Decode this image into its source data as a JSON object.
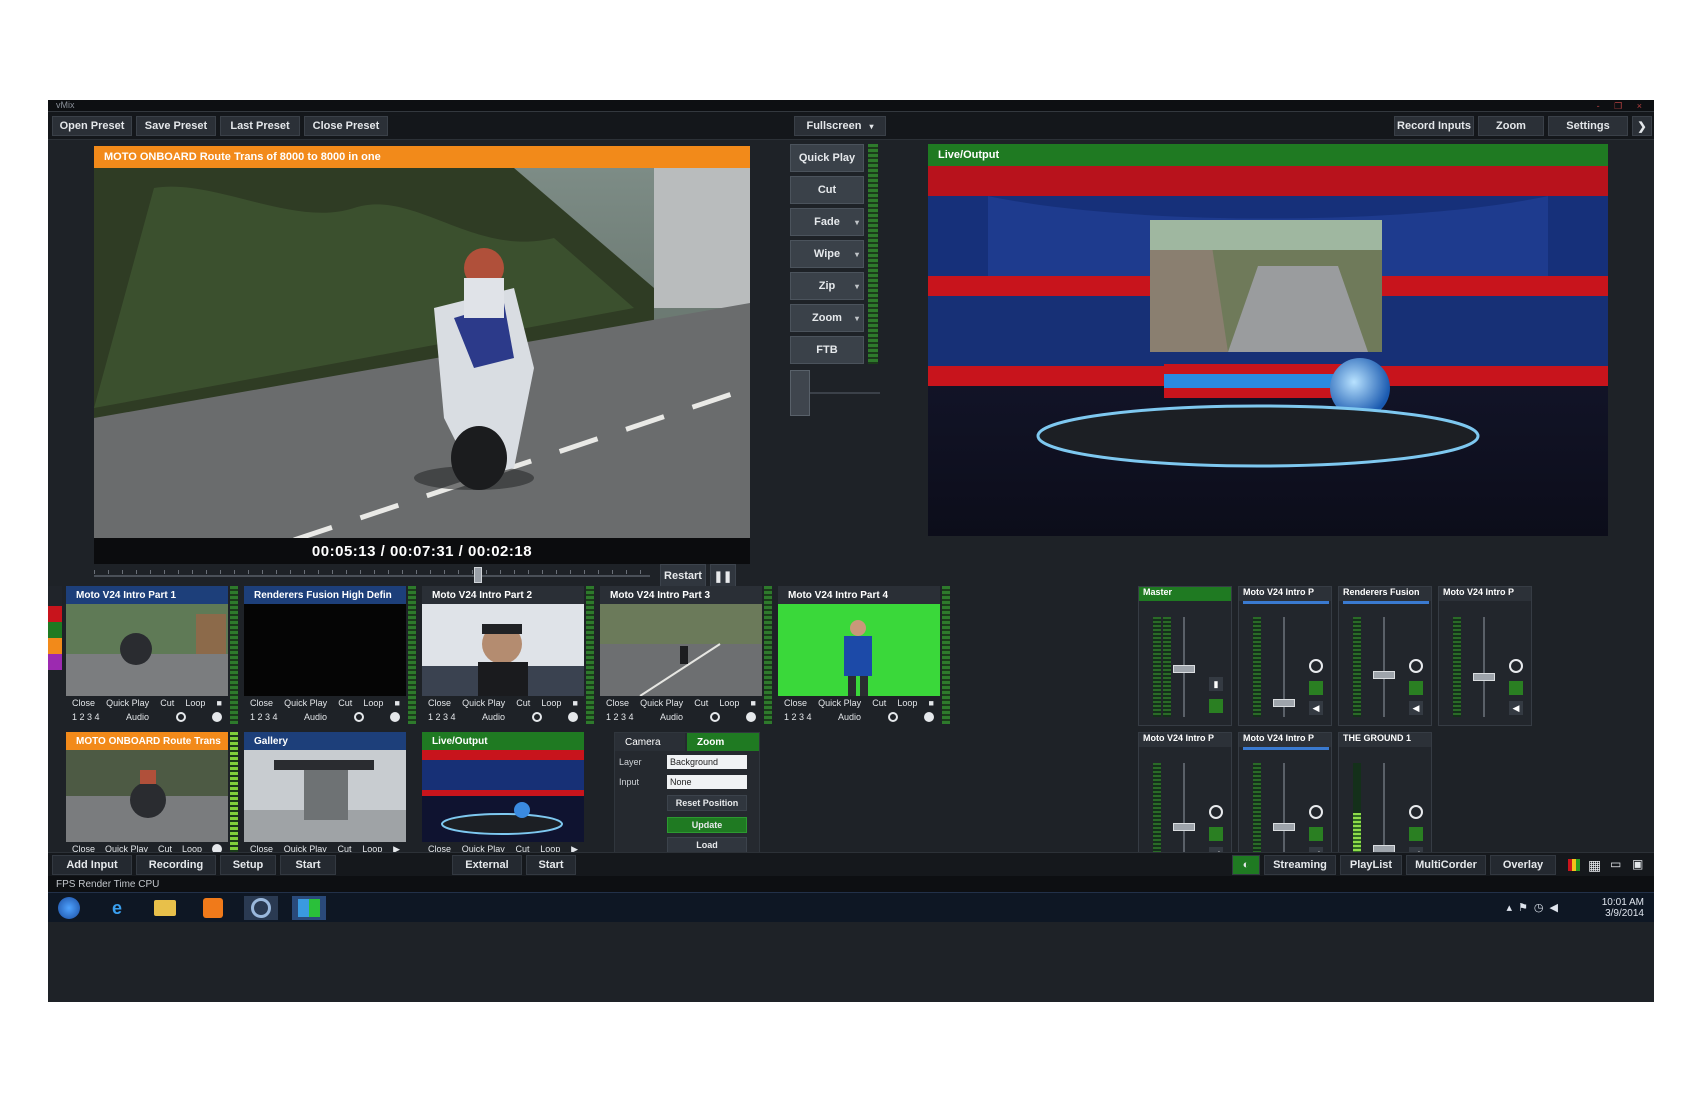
{
  "window": {
    "title": "vMix",
    "controls": "- ❐ ×"
  },
  "toolbar": {
    "left": [
      "Open Preset",
      "Save Preset",
      "Last Preset",
      "Close Preset"
    ],
    "center": "Fullscreen",
    "right": [
      "Record Inputs",
      "Zoom",
      "Settings",
      "❯"
    ]
  },
  "preview": {
    "caption": "MOTO ONBOARD Route Trans of 8000 to 8000 in one",
    "timecode": "00:05:13 / 00:07:31 / 00:02:18",
    "transport": {
      "button": "Restart",
      "pause": "❚❚"
    }
  },
  "transitions": [
    "Quick Play",
    "Cut",
    "Fade",
    "Wipe",
    "Zip",
    "Zoom",
    "FTB"
  ],
  "output": {
    "caption": "Live/Output"
  },
  "inputs_row1": [
    {
      "caption": "Moto V24 Intro Part 1",
      "cap_color": "blue",
      "bottom": "1 2 3 4"
    },
    {
      "caption": "Renderers Fusion High Defin",
      "cap_color": "blue",
      "bottom": "1 2 3 4"
    },
    {
      "caption": "Moto V24 Intro Part 2",
      "cap_color": "dark",
      "bottom": "1 2 3 4"
    },
    {
      "caption": "Moto V24 Intro Part 3",
      "cap_color": "dark",
      "bottom": "1 2 3 4"
    },
    {
      "caption": "Moto V24 Intro Part 4",
      "cap_color": "dark",
      "bottom": "1 2 3 4"
    }
  ],
  "inputs_row2": [
    {
      "caption": "MOTO ONBOARD Route Trans",
      "cap_color": "orange"
    },
    {
      "caption": "Gallery",
      "cap_color": "blue"
    },
    {
      "caption": "Live/Output",
      "cap_color": "green"
    }
  ],
  "input_controls": {
    "close": "Close",
    "quick_play": "Quick Play",
    "cut": "Cut",
    "loop": "Loop",
    "audio": "Audio"
  },
  "controls_panel": {
    "tab_camera": "Camera",
    "tab_zoom": "Zoom",
    "layer_label": "Layer",
    "layer_value": "Background",
    "input_label": "Input",
    "input_value": "None",
    "reset_btn": "Reset Position",
    "update_btn": "Update",
    "load_btn": "Load"
  },
  "mixers": [
    {
      "name": "Master",
      "header": "green"
    },
    {
      "name": "Moto V24 Intro P",
      "header": "dark"
    },
    {
      "name": "Renderers Fusion",
      "header": "dark"
    },
    {
      "name": "Moto V24 Intro P",
      "header": "dark"
    },
    {
      "name": "Moto V24 Intro P",
      "header": "dark"
    },
    {
      "name": "Moto V24 Intro P",
      "header": "dark"
    },
    {
      "name": "THE GROUND 1",
      "header": "dark"
    }
  ],
  "bottom_bar": {
    "left": [
      "Add Input",
      "Recording",
      "Setup",
      "Start"
    ],
    "center": [
      "External",
      "Start"
    ],
    "right": [
      "Streaming",
      "PlayList",
      "MultiCorder",
      "Overlay"
    ]
  },
  "status": "FPS  Render Time  CPU",
  "taskbar": {
    "time": "10:01 AM",
    "date": "3/9/2014"
  },
  "colors": {
    "orange": "#f28a1a",
    "green": "#1f7a22",
    "blue": "#1d3f7a",
    "app_bg": "#1e2227"
  }
}
